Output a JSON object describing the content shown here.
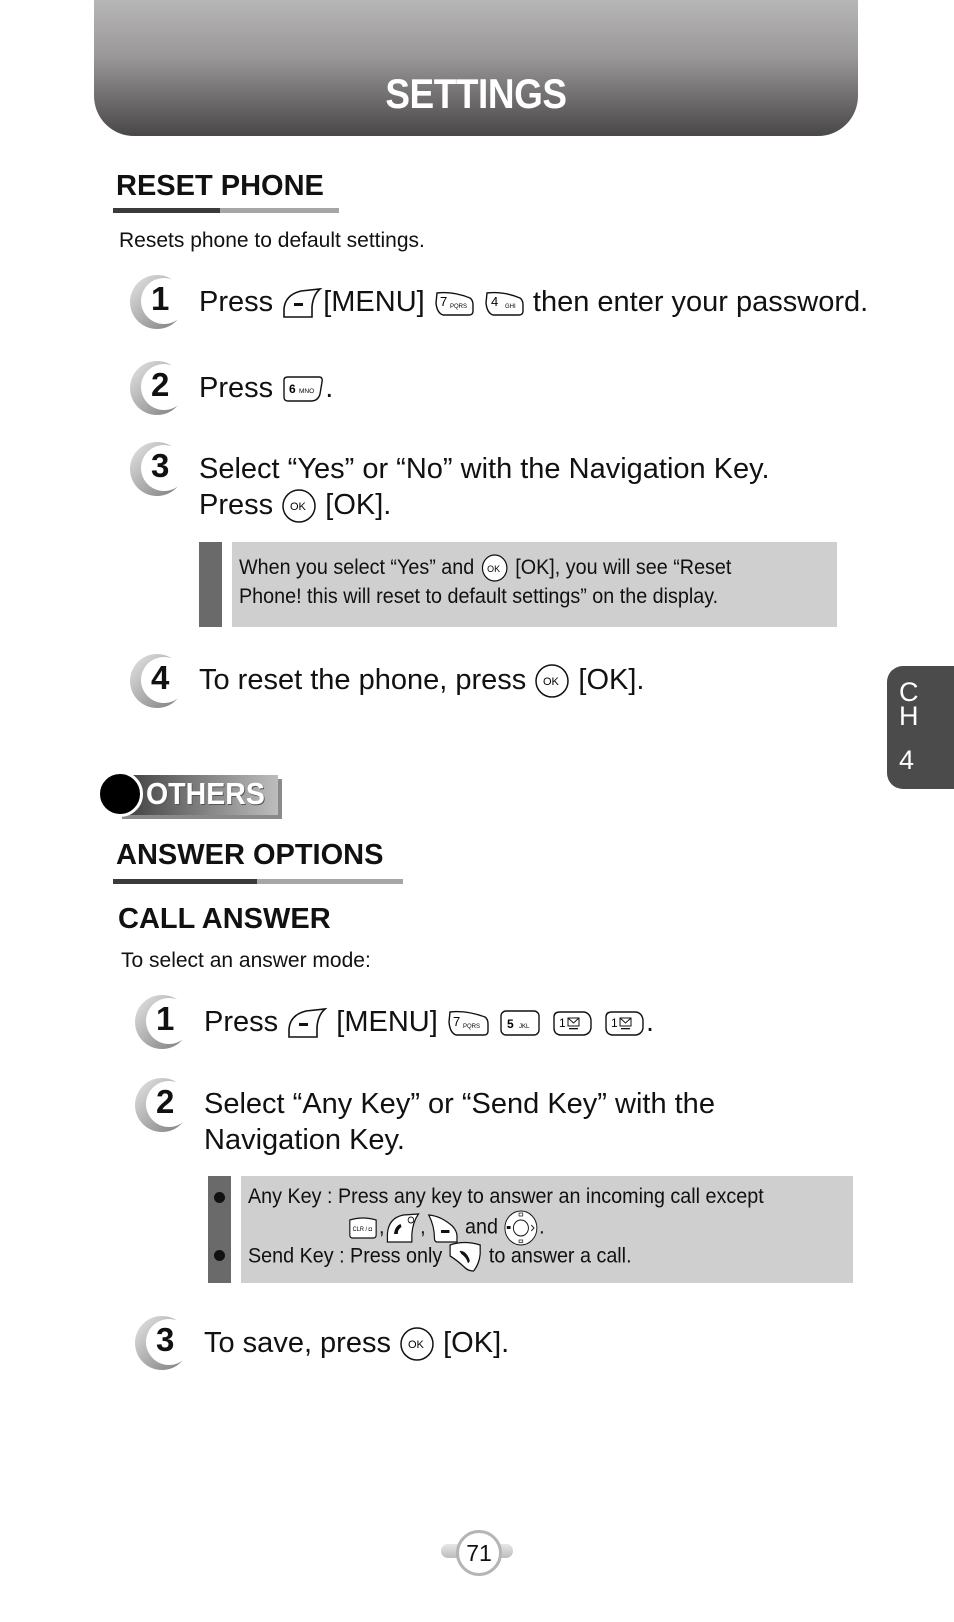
{
  "header": {
    "title": "SETTINGS"
  },
  "chapter_tab": {
    "letters": [
      "C",
      "H"
    ],
    "number": "4"
  },
  "reset_phone": {
    "title": "RESET PHONE",
    "description": "Resets phone to default settings.",
    "steps": [
      {
        "number": "1",
        "parts": {
          "press": "Press",
          "menu": "[MENU]",
          "rest": "then enter your password."
        },
        "keys": [
          "left-softkey",
          "7 PQRS",
          "4 GHI"
        ]
      },
      {
        "number": "2",
        "parts": {
          "press": "Press",
          "end": "."
        },
        "keys": [
          "6 MNO"
        ]
      },
      {
        "number": "3",
        "line1": "Select “Yes” or “No” with the Navigation Key.",
        "parts": {
          "press": "Press",
          "ok": "[OK]."
        },
        "keys": [
          "OK"
        ]
      },
      {
        "number": "4",
        "parts": {
          "text": "To reset the phone, press",
          "ok": "[OK]."
        },
        "keys": [
          "OK"
        ]
      }
    ],
    "note": {
      "line1_pre": "When you select “Yes” and",
      "line1_post": "[OK], you will see “Reset",
      "line2": "Phone! this will reset to default settings” on the display.",
      "key": "OK"
    }
  },
  "others": {
    "label": "OTHERS",
    "section_title": "ANSWER OPTIONS",
    "subsection_title": "CALL ANSWER",
    "description": "To select an answer mode:",
    "steps": [
      {
        "number": "1",
        "parts": {
          "press": "Press",
          "menu": "[MENU]",
          "end": "."
        },
        "keys": [
          "left-softkey",
          "7 PQRS",
          "5 JKL",
          "1 voicemail",
          "1 voicemail"
        ]
      },
      {
        "number": "2",
        "line1": "Select “Any Key” or “Send Key” with the",
        "line2": "Navigation Key."
      },
      {
        "number": "3",
        "parts": {
          "text": "To save, press",
          "ok": "[OK]."
        },
        "keys": [
          "OK"
        ]
      }
    ],
    "note": {
      "any_key_line1": "Any Key : Press any key to answer an incoming call except",
      "any_key_sep1": ",",
      "any_key_sep2": ",",
      "any_key_and": "and",
      "any_key_end": ".",
      "any_key_keys": [
        "CLR / camera",
        "power-end",
        "right-softkey",
        "navigation-key"
      ],
      "send_key_pre": "Send Key : Press only",
      "send_key_post": "to answer a call.",
      "send_key_key": "send"
    }
  },
  "page_number": "71",
  "colors": {
    "header_top": "#bdbcbc",
    "header_bottom": "#4a4748",
    "note_background": "#cfcfcf",
    "note_bar": "#6a6a6a",
    "tab": "#4b4b4b"
  }
}
